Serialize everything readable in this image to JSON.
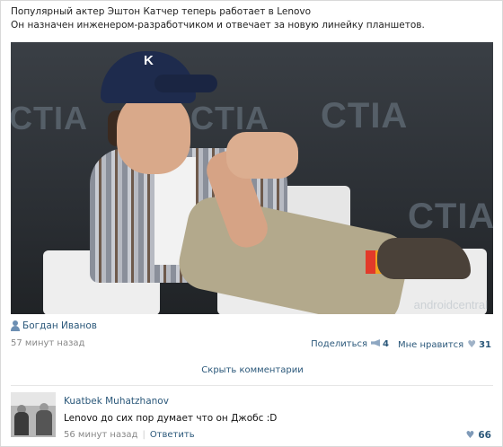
{
  "post": {
    "line1": "Популярный актер Эштон Катчер теперь работает в Lenovo",
    "line2": "Он назначен инженером-разработчиком и отвечает за новую линейку планшетов.",
    "photo": {
      "backdrop_text": "CTIA",
      "cap_letter": "K",
      "watermark": "androidcentral"
    },
    "author": "Богдан Иванов",
    "time": "57 минут назад",
    "share_label": "Поделиться",
    "share_count": "4",
    "like_label": "Мне нравится",
    "like_count": "31",
    "hide_comments": "Скрыть комментарии"
  },
  "comment": {
    "author": "Kuatbek Muhatzhanov",
    "text": "Lenovo до сих пор думает что он Джобс :D",
    "time": "56 минут назад",
    "separator": "|",
    "reply_label": "Ответить",
    "likes": "66"
  },
  "colors": {
    "link": "#2b587a",
    "muted": "#888888"
  },
  "icons": [
    "user-icon",
    "megaphone-icon",
    "heart-icon"
  ]
}
